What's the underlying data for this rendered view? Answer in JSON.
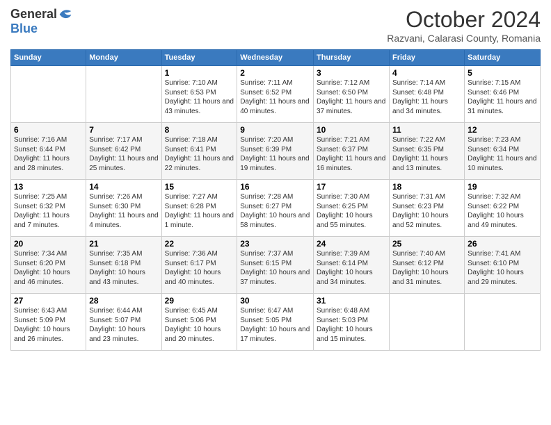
{
  "header": {
    "logo_general": "General",
    "logo_blue": "Blue",
    "month_title": "October 2024",
    "location": "Razvani, Calarasi County, Romania"
  },
  "days_of_week": [
    "Sunday",
    "Monday",
    "Tuesday",
    "Wednesday",
    "Thursday",
    "Friday",
    "Saturday"
  ],
  "weeks": [
    [
      {
        "day": "",
        "info": ""
      },
      {
        "day": "",
        "info": ""
      },
      {
        "day": "1",
        "info": "Sunrise: 7:10 AM\nSunset: 6:53 PM\nDaylight: 11 hours and 43 minutes."
      },
      {
        "day": "2",
        "info": "Sunrise: 7:11 AM\nSunset: 6:52 PM\nDaylight: 11 hours and 40 minutes."
      },
      {
        "day": "3",
        "info": "Sunrise: 7:12 AM\nSunset: 6:50 PM\nDaylight: 11 hours and 37 minutes."
      },
      {
        "day": "4",
        "info": "Sunrise: 7:14 AM\nSunset: 6:48 PM\nDaylight: 11 hours and 34 minutes."
      },
      {
        "day": "5",
        "info": "Sunrise: 7:15 AM\nSunset: 6:46 PM\nDaylight: 11 hours and 31 minutes."
      }
    ],
    [
      {
        "day": "6",
        "info": "Sunrise: 7:16 AM\nSunset: 6:44 PM\nDaylight: 11 hours and 28 minutes."
      },
      {
        "day": "7",
        "info": "Sunrise: 7:17 AM\nSunset: 6:42 PM\nDaylight: 11 hours and 25 minutes."
      },
      {
        "day": "8",
        "info": "Sunrise: 7:18 AM\nSunset: 6:41 PM\nDaylight: 11 hours and 22 minutes."
      },
      {
        "day": "9",
        "info": "Sunrise: 7:20 AM\nSunset: 6:39 PM\nDaylight: 11 hours and 19 minutes."
      },
      {
        "day": "10",
        "info": "Sunrise: 7:21 AM\nSunset: 6:37 PM\nDaylight: 11 hours and 16 minutes."
      },
      {
        "day": "11",
        "info": "Sunrise: 7:22 AM\nSunset: 6:35 PM\nDaylight: 11 hours and 13 minutes."
      },
      {
        "day": "12",
        "info": "Sunrise: 7:23 AM\nSunset: 6:34 PM\nDaylight: 11 hours and 10 minutes."
      }
    ],
    [
      {
        "day": "13",
        "info": "Sunrise: 7:25 AM\nSunset: 6:32 PM\nDaylight: 11 hours and 7 minutes."
      },
      {
        "day": "14",
        "info": "Sunrise: 7:26 AM\nSunset: 6:30 PM\nDaylight: 11 hours and 4 minutes."
      },
      {
        "day": "15",
        "info": "Sunrise: 7:27 AM\nSunset: 6:28 PM\nDaylight: 11 hours and 1 minute."
      },
      {
        "day": "16",
        "info": "Sunrise: 7:28 AM\nSunset: 6:27 PM\nDaylight: 10 hours and 58 minutes."
      },
      {
        "day": "17",
        "info": "Sunrise: 7:30 AM\nSunset: 6:25 PM\nDaylight: 10 hours and 55 minutes."
      },
      {
        "day": "18",
        "info": "Sunrise: 7:31 AM\nSunset: 6:23 PM\nDaylight: 10 hours and 52 minutes."
      },
      {
        "day": "19",
        "info": "Sunrise: 7:32 AM\nSunset: 6:22 PM\nDaylight: 10 hours and 49 minutes."
      }
    ],
    [
      {
        "day": "20",
        "info": "Sunrise: 7:34 AM\nSunset: 6:20 PM\nDaylight: 10 hours and 46 minutes."
      },
      {
        "day": "21",
        "info": "Sunrise: 7:35 AM\nSunset: 6:18 PM\nDaylight: 10 hours and 43 minutes."
      },
      {
        "day": "22",
        "info": "Sunrise: 7:36 AM\nSunset: 6:17 PM\nDaylight: 10 hours and 40 minutes."
      },
      {
        "day": "23",
        "info": "Sunrise: 7:37 AM\nSunset: 6:15 PM\nDaylight: 10 hours and 37 minutes."
      },
      {
        "day": "24",
        "info": "Sunrise: 7:39 AM\nSunset: 6:14 PM\nDaylight: 10 hours and 34 minutes."
      },
      {
        "day": "25",
        "info": "Sunrise: 7:40 AM\nSunset: 6:12 PM\nDaylight: 10 hours and 31 minutes."
      },
      {
        "day": "26",
        "info": "Sunrise: 7:41 AM\nSunset: 6:10 PM\nDaylight: 10 hours and 29 minutes."
      }
    ],
    [
      {
        "day": "27",
        "info": "Sunrise: 6:43 AM\nSunset: 5:09 PM\nDaylight: 10 hours and 26 minutes."
      },
      {
        "day": "28",
        "info": "Sunrise: 6:44 AM\nSunset: 5:07 PM\nDaylight: 10 hours and 23 minutes."
      },
      {
        "day": "29",
        "info": "Sunrise: 6:45 AM\nSunset: 5:06 PM\nDaylight: 10 hours and 20 minutes."
      },
      {
        "day": "30",
        "info": "Sunrise: 6:47 AM\nSunset: 5:05 PM\nDaylight: 10 hours and 17 minutes."
      },
      {
        "day": "31",
        "info": "Sunrise: 6:48 AM\nSunset: 5:03 PM\nDaylight: 10 hours and 15 minutes."
      },
      {
        "day": "",
        "info": ""
      },
      {
        "day": "",
        "info": ""
      }
    ]
  ]
}
